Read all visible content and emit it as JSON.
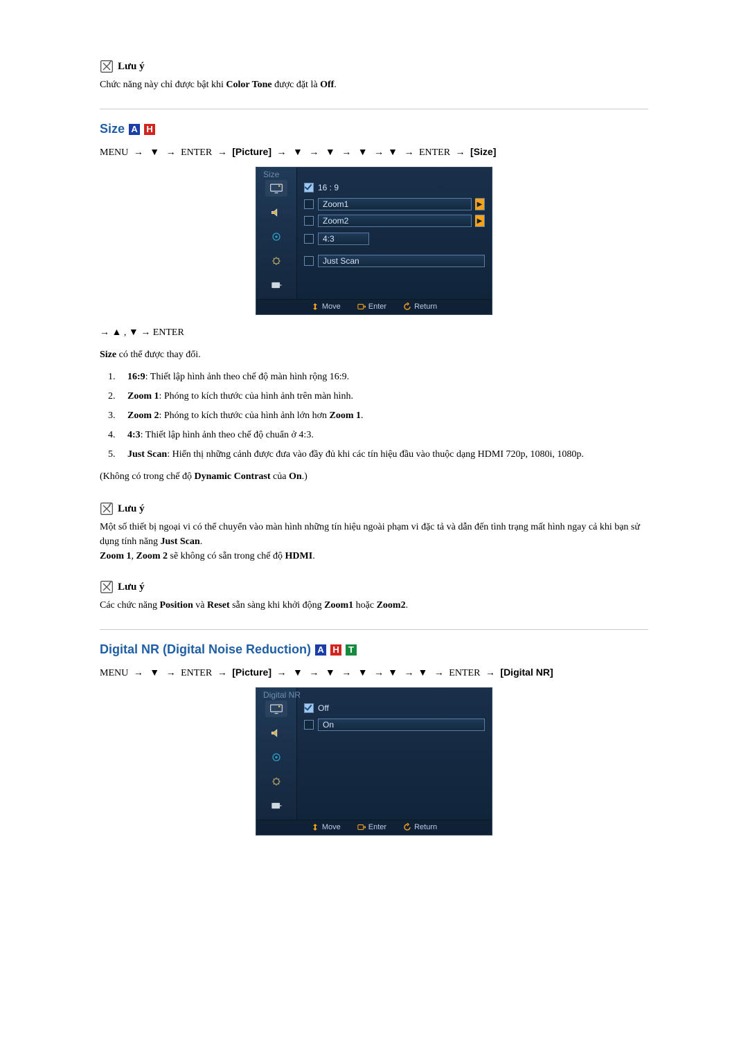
{
  "note1": {
    "label": "Lưu ý",
    "text_before": "Chức năng này chỉ được bật khi ",
    "bold": "Color Tone",
    "text_mid": " được đặt là ",
    "bold2": "Off",
    "text_after": "."
  },
  "size_section": {
    "title": "Size",
    "modes": [
      "A",
      "H"
    ],
    "menu_path": {
      "menu": "MENU",
      "enter": "ENTER",
      "picture": "[Picture]",
      "size": "[Size]"
    },
    "osd": {
      "title": "Size",
      "options": [
        {
          "label": "16 : 9",
          "checked": true,
          "narrow": false,
          "more": false
        },
        {
          "label": "Zoom1",
          "checked": false,
          "narrow": false,
          "more": true
        },
        {
          "label": "Zoom2",
          "checked": false,
          "narrow": false,
          "more": true
        },
        {
          "label": "4:3",
          "checked": false,
          "narrow": true,
          "more": false
        },
        {
          "label": "Just Scan",
          "checked": false,
          "narrow": false,
          "more": false
        }
      ],
      "footer": {
        "move": "Move",
        "enter": "Enter",
        "return": "Return"
      }
    },
    "post_nav": "→ ▲ , ▼ → ENTER",
    "change_text": {
      "bold": "Size",
      "rest": " có thể được thay đổi."
    },
    "items": [
      {
        "name": "16:9",
        "desc": ": Thiết lập hình ảnh theo chế độ màn hình rộng 16:9."
      },
      {
        "name": "Zoom 1",
        "desc": ": Phóng to kích thước của hình ảnh trên màn hình."
      },
      {
        "name": "Zoom 2",
        "desc": ": Phóng to kích thước của hình ảnh lớn hơn ",
        "tail_bold": "Zoom 1",
        "tail_after": "."
      },
      {
        "name": "4:3",
        "desc": ": Thiết lập hình ảnh theo chế độ chuẩn ở 4:3."
      },
      {
        "name": "Just Scan",
        "desc": ": Hiển thị những cảnh được đưa vào đầy đủ khi các tín hiệu đầu vào thuộc dạng HDMI 720p, 1080i, 1080p."
      }
    ],
    "unavailable": {
      "before": "(Không có trong chế độ ",
      "bold1": "Dynamic Contrast",
      "mid": " của ",
      "bold2": "On",
      "after": ".)"
    }
  },
  "note2": {
    "label": "Lưu ý",
    "line1_before": "Một số thiết bị ngoại vi có thể chuyển vào màn hình những tín hiệu ngoài phạm vi đặc tả và dẫn đến tình trạng mất hình ngay cả khi bạn sử dụng tính năng ",
    "line1_bold": "Just Scan",
    "line1_after": ".",
    "line2_b1": "Zoom 1",
    "line2_mid1": ", ",
    "line2_b2": "Zoom 2",
    "line2_mid2": " sẽ không có sẵn trong chế độ ",
    "line2_b3": "HDMI",
    "line2_after": "."
  },
  "note3": {
    "label": "Lưu ý",
    "before": "Các chức năng ",
    "b1": "Position",
    "mid1": " và ",
    "b2": "Reset",
    "mid2": " sẵn sàng khi khởi động ",
    "b3": "Zoom1",
    "mid3": " hoặc ",
    "b4": "Zoom2",
    "after": "."
  },
  "dnr_section": {
    "title": "Digital NR (Digital Noise Reduction)",
    "modes": [
      "A",
      "H",
      "T"
    ],
    "menu_path": {
      "menu": "MENU",
      "enter": "ENTER",
      "picture": "[Picture]",
      "dnr": "[Digital NR]"
    },
    "osd": {
      "title": "Digital  NR",
      "options": [
        {
          "label": "Off",
          "checked": true
        },
        {
          "label": "On",
          "checked": false
        }
      ],
      "footer": {
        "move": "Move",
        "enter": "Enter",
        "return": "Return"
      }
    }
  }
}
